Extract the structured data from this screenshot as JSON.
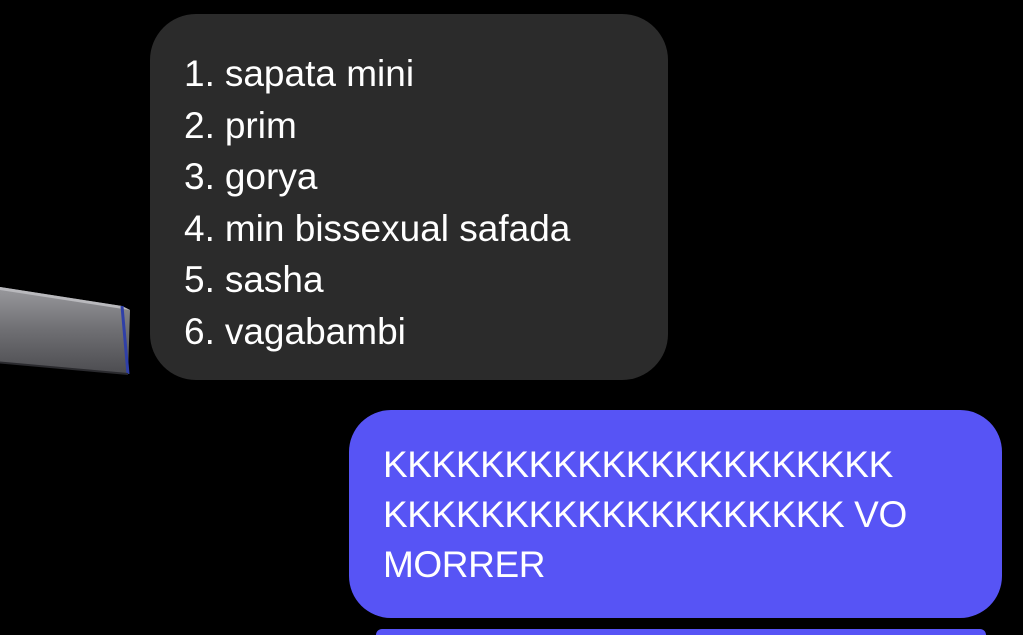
{
  "conversation": {
    "incoming_message": {
      "lines": [
        {
          "number": "1.",
          "text": "sapata mini"
        },
        {
          "number": "2.",
          "text": "prim"
        },
        {
          "number": "3.",
          "text": "gorya"
        },
        {
          "number": "4.",
          "text": "min bissexual safada"
        },
        {
          "number": "5.",
          "text": "sasha"
        },
        {
          "number": "6.",
          "text": "vagabambi"
        }
      ]
    },
    "outgoing_message": {
      "lines": [
        "KKKKKKKKKKKKKKKKKKKKK",
        "KKKKKKKKKKKKKKKKKKK VO",
        "MORRER"
      ]
    }
  },
  "colors": {
    "background": "#000000",
    "incoming_bubble": "#2b2b2b",
    "outgoing_bubble": "#5754f5",
    "text": "#ffffff"
  }
}
